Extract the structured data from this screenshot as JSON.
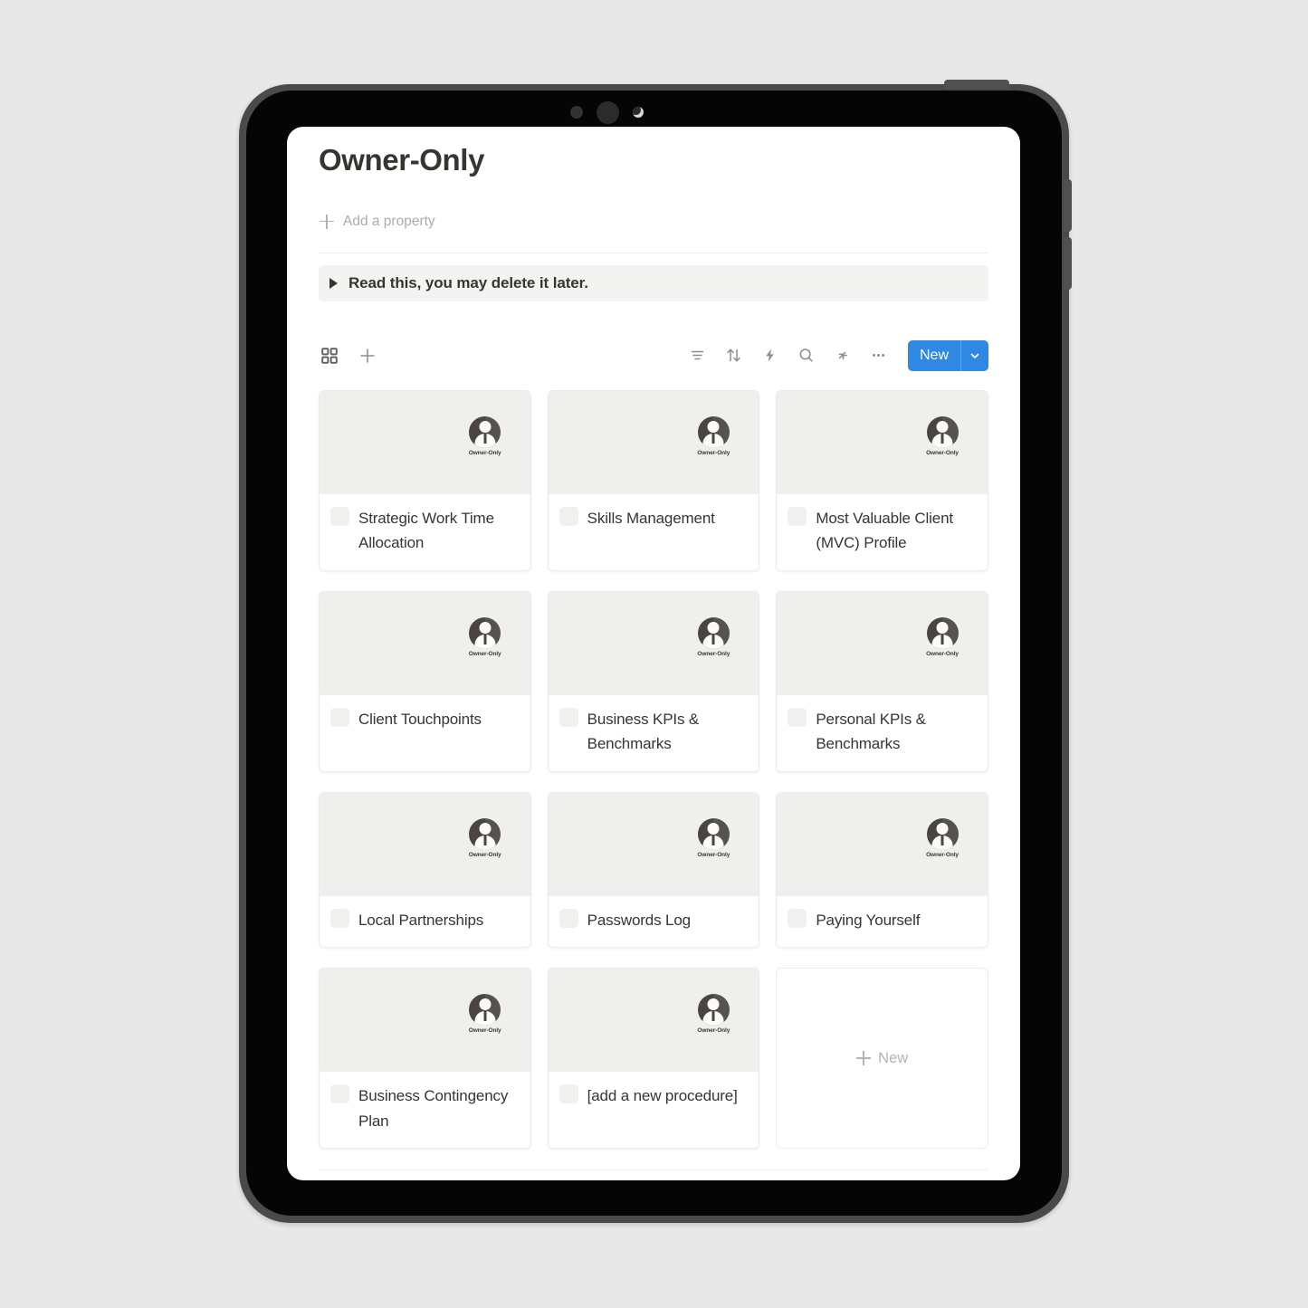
{
  "device": {
    "type": "tablet",
    "sensors": [
      "sensor-dot",
      "front-camera",
      "ambient-light-sensor"
    ]
  },
  "page": {
    "title": "Owner-Only",
    "add_property_label": "Add a property",
    "toggle_block_text": "Read this, you may delete it later."
  },
  "toolbar": {
    "view_icon": "gallery-view-icon",
    "add_view_icon": "plus-icon",
    "right_icons": [
      {
        "name": "filter-icon",
        "glyph": "filter"
      },
      {
        "name": "sort-icon",
        "glyph": "sort"
      },
      {
        "name": "automation-icon",
        "glyph": "lightning"
      },
      {
        "name": "search-icon",
        "glyph": "magnifier"
      },
      {
        "name": "expand-icon",
        "glyph": "collapse-arrows"
      },
      {
        "name": "more-options-icon",
        "glyph": "ellipsis"
      }
    ],
    "new_label": "New",
    "new_caret": "chevron-down-icon",
    "new_button_color": "#2e88e4"
  },
  "gallery": {
    "cover_badge_label": "Owner-Only",
    "cover_color": "#efefee",
    "avatar_color": "#4a4540",
    "cards": [
      {
        "title": "Strategic Work Time Allocation",
        "badge": "Owner-Only"
      },
      {
        "title": "Skills Management",
        "badge": "Owner-Only"
      },
      {
        "title": "Most Valuable Client (MVC) Profile",
        "badge": "Owner-Only"
      },
      {
        "title": "Client Touchpoints",
        "badge": "Owner-Only"
      },
      {
        "title": "Business KPIs & Benchmarks",
        "badge": "Owner-Only"
      },
      {
        "title": "Personal KPIs & Benchmarks",
        "badge": "Owner-Only"
      },
      {
        "title": "Local Partnerships",
        "badge": "Owner-Only"
      },
      {
        "title": "Passwords Log",
        "badge": "Owner-Only"
      },
      {
        "title": "Paying Yourself",
        "badge": "Owner-Only"
      },
      {
        "title": "Business Contingency Plan",
        "badge": "Owner-Only"
      },
      {
        "title": "[add a new procedure]",
        "badge": "Owner-Only"
      }
    ],
    "new_card_label": "New"
  }
}
